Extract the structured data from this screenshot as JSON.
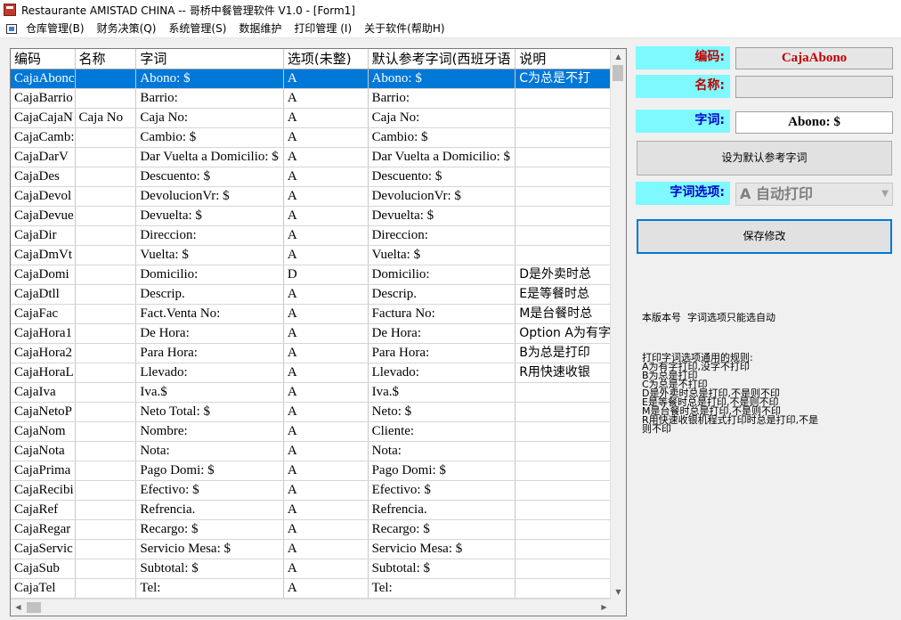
{
  "window": {
    "title": "Restaurante AMISTAD CHINA -- 哥桥中餐管理软件 V1.0 - [Form1]"
  },
  "menu": [
    "仓库管理(B)",
    "财务决策(Q)",
    "系统管理(S)",
    "数据维护",
    "打印管理 (I)",
    "关于软件(帮助H)"
  ],
  "grid": {
    "headers": [
      "编码",
      "名称",
      "字词",
      "选项(未整)",
      "默认参考字词(西班牙语",
      "说明"
    ],
    "rows": [
      [
        "CajaAbonc",
        "",
        "Abono: $",
        "A",
        "Abono: $",
        "C为总是不打"
      ],
      [
        "CajaBarrio",
        "",
        "Barrio:",
        "A",
        "Barrio:",
        ""
      ],
      [
        "CajaCajaN",
        "Caja No",
        "Caja No:",
        "A",
        "Caja No:",
        ""
      ],
      [
        "CajaCamb:",
        "",
        "Cambio: $",
        "A",
        "Cambio: $",
        ""
      ],
      [
        "CajaDarV",
        "",
        "Dar Vuelta a Domicilio: $",
        "A",
        "Dar Vuelta a Domicilio: $",
        ""
      ],
      [
        "CajaDes",
        "",
        "Descuento: $",
        "A",
        "Descuento: $",
        ""
      ],
      [
        "CajaDevol",
        "",
        "DevolucionVr: $",
        "A",
        "DevolucionVr: $",
        ""
      ],
      [
        "CajaDevue",
        "",
        "Devuelta: $",
        "A",
        "Devuelta: $",
        ""
      ],
      [
        "CajaDir",
        "",
        "Direccion:",
        "A",
        "Direccion:",
        ""
      ],
      [
        "CajaDmVt",
        "",
        "Vuelta: $",
        "A",
        "Vuelta: $",
        ""
      ],
      [
        "CajaDomi",
        "",
        "Domicilio:",
        "D",
        "Domicilio:",
        "D是外卖时总"
      ],
      [
        "CajaDtll",
        "",
        "Descrip.",
        "A",
        "Descrip.",
        "E是等餐时总"
      ],
      [
        "CajaFac",
        "",
        "Fact.Venta No:",
        "A",
        "Factura No:",
        "M是台餐时总"
      ],
      [
        "CajaHora1",
        "",
        "De Hora:",
        "A",
        "De Hora:",
        "Option A为有字"
      ],
      [
        "CajaHora2",
        "",
        "Para Hora:",
        "A",
        "Para Hora:",
        "B为总是打印"
      ],
      [
        "CajaHoraL",
        "",
        "Llevado:",
        "A",
        "Llevado:",
        "R用快速收银"
      ],
      [
        "CajaIva",
        "",
        "Iva.$",
        "A",
        "Iva.$",
        ""
      ],
      [
        "CajaNetoP",
        "",
        "Neto Total: $",
        "A",
        "Neto: $",
        ""
      ],
      [
        "CajaNom",
        "",
        "Nombre:",
        "A",
        "Cliente:",
        ""
      ],
      [
        "CajaNota",
        "",
        "Nota:",
        "A",
        "Nota:",
        ""
      ],
      [
        "CajaPrima",
        "",
        "Pago Domi: $",
        "A",
        "Pago Domi: $",
        ""
      ],
      [
        "CajaRecibi",
        "",
        "Efectivo: $",
        "A",
        "Efectivo: $",
        ""
      ],
      [
        "CajaRef",
        "",
        "Refrencia.",
        "A",
        "Refrencia.",
        ""
      ],
      [
        "CajaRegar",
        "",
        "Recargo: $",
        "A",
        "Recargo: $",
        ""
      ],
      [
        "CajaServic",
        "",
        "Servicio Mesa: $",
        "A",
        "Servicio Mesa: $",
        ""
      ],
      [
        "CajaSub",
        "",
        "Subtotal: $",
        "A",
        "Subtotal: $",
        ""
      ],
      [
        "CajaTel",
        "",
        "Tel:",
        "A",
        "Tel:",
        ""
      ]
    ]
  },
  "form": {
    "code_label": "编码:",
    "code_value": "CajaAbono",
    "name_label": "名称:",
    "name_value": "",
    "word_label": "字词:",
    "word_value": "Abono: $",
    "set_default_button": "设为默认参考字词",
    "option_label": "字词选项:",
    "option_value": "A 自动打印",
    "save_button": "保存修改",
    "version_note": "本版本号  字词选项只能选自动",
    "rules": [
      "打印字词选项通用的规则:",
      "A为有字打印,没字不打印",
      "B为总是打印",
      "C为总是不打印",
      "D是外卖时总是打印,不是则不印",
      "E是等餐时总是打印,不是则不印",
      "M是台餐时总是打印,不是则不印",
      "R用快速收银机程式打印时总是打印,不是",
      "则不印"
    ]
  },
  "colors": {
    "selection": "#0078d7",
    "label_bg": "#7df9ff",
    "label_red": "#c00000",
    "label_blue": "#0000cc"
  }
}
